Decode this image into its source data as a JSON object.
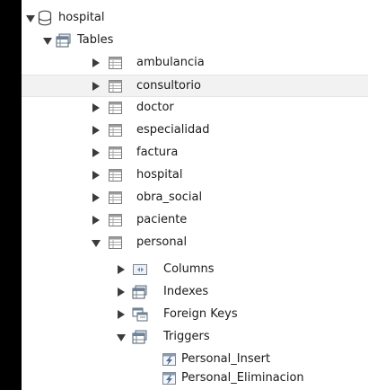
{
  "tree": {
    "schema": {
      "label": "hospital",
      "icon": "database-icon",
      "expanded": true
    },
    "tables_folder": {
      "label": "Tables",
      "icon": "tables-folder-icon",
      "expanded": true
    },
    "tables": [
      {
        "label": "ambulancia",
        "expanded": false,
        "selected": false
      },
      {
        "label": "consultorio",
        "expanded": false,
        "selected": true
      },
      {
        "label": "doctor",
        "expanded": false,
        "selected": false
      },
      {
        "label": "especialidad",
        "expanded": false,
        "selected": false
      },
      {
        "label": "factura",
        "expanded": false,
        "selected": false
      },
      {
        "label": "hospital",
        "expanded": false,
        "selected": false
      },
      {
        "label": "obra_social",
        "expanded": false,
        "selected": false
      },
      {
        "label": "paciente",
        "expanded": false,
        "selected": false
      },
      {
        "label": "personal",
        "expanded": true,
        "selected": false
      }
    ],
    "personal_children": [
      {
        "label": "Columns",
        "icon": "columns-folder-icon",
        "expanded": false
      },
      {
        "label": "Indexes",
        "icon": "indexes-folder-icon",
        "expanded": false
      },
      {
        "label": "Foreign Keys",
        "icon": "foreign-keys-folder-icon",
        "expanded": false
      },
      {
        "label": "Triggers",
        "icon": "triggers-folder-icon",
        "expanded": true
      }
    ],
    "triggers": [
      {
        "label": "Personal_Insert",
        "icon": "trigger-icon"
      },
      {
        "label": "Personal_Eliminacion",
        "icon": "trigger-icon"
      }
    ]
  }
}
